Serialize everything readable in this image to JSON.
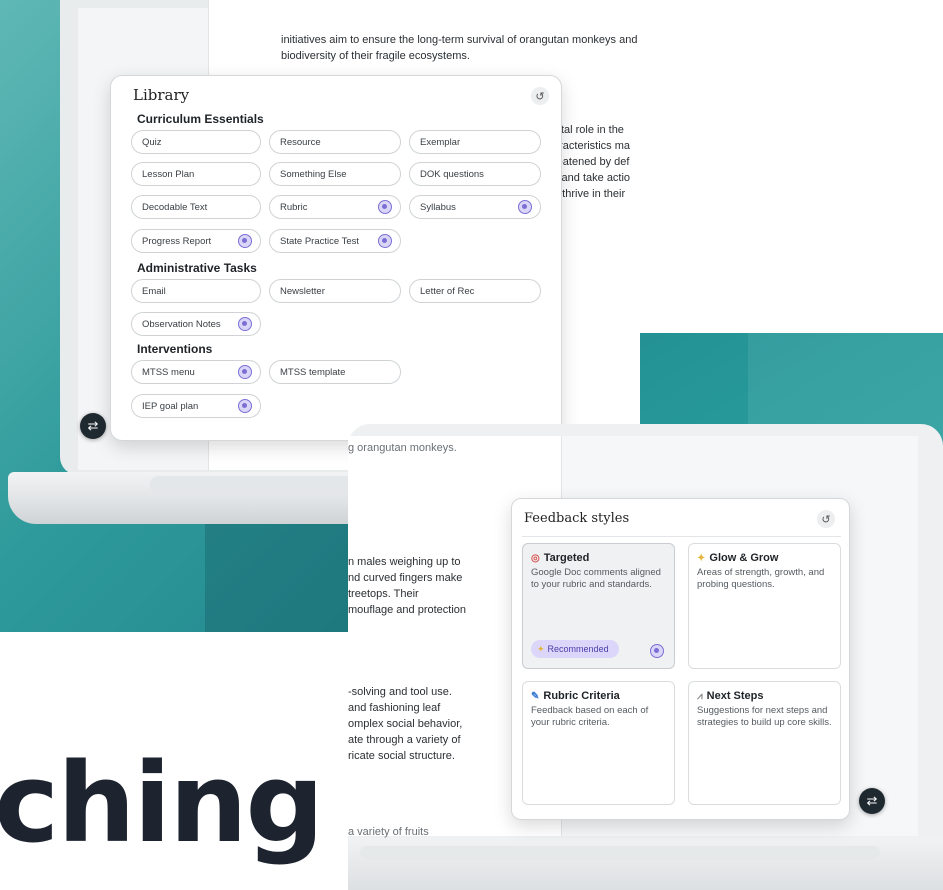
{
  "hero_word": "ching",
  "doc1": {
    "top_lines": [
      "initiatives aim to ensure the long-term survival of orangutan monkeys and",
      "biodiversity of their fragile ecosystems."
    ],
    "right_lines": [
      "vital role in the",
      "aracteristics ma",
      "reatened by def",
      "s and take actio",
      "o thrive in their"
    ]
  },
  "library": {
    "title": "Library",
    "sections": [
      {
        "heading": "Curriculum Essentials",
        "items": [
          {
            "label": "Quiz",
            "badge": false
          },
          {
            "label": "Resource",
            "badge": false
          },
          {
            "label": "Exemplar",
            "badge": false
          },
          {
            "label": "Lesson Plan",
            "badge": false
          },
          {
            "label": "Something Else",
            "badge": false
          },
          {
            "label": "DOK questions",
            "badge": false
          },
          {
            "label": "Decodable Text",
            "badge": false
          },
          {
            "label": "Rubric",
            "badge": true
          },
          {
            "label": "Syllabus",
            "badge": true
          },
          {
            "label": "Progress Report",
            "badge": true
          },
          {
            "label": "State Practice Test",
            "badge": true
          }
        ]
      },
      {
        "heading": "Administrative Tasks",
        "items": [
          {
            "label": "Email",
            "badge": false
          },
          {
            "label": "Newsletter",
            "badge": false
          },
          {
            "label": "Letter of Rec",
            "badge": false
          },
          {
            "label": "Observation Notes",
            "badge": true
          }
        ]
      },
      {
        "heading": "Interventions",
        "items": [
          {
            "label": "MTSS menu",
            "badge": true
          },
          {
            "label": "MTSS template",
            "badge": false
          },
          {
            "label": "IEP goal plan",
            "badge": true
          }
        ]
      }
    ]
  },
  "doc2": {
    "line_a": "g orangutan monkeys.",
    "block1": [
      "n males weighing up to",
      "nd curved fingers make",
      "treetops. Their",
      "mouflage and protection"
    ],
    "block2": [
      "-solving and tool use.",
      "and fashioning leaf",
      "omplex social behavior,",
      "ate through a variety of",
      "ricate social structure."
    ],
    "line_b": "a variety of fruits"
  },
  "feedback": {
    "title": "Feedback styles",
    "cards": [
      {
        "icon": "target-icon",
        "glyph": "◎",
        "title": "Targeted",
        "desc": "Google Doc comments aligned to your rubric and standards.",
        "recommended": "Recommended",
        "selected": true
      },
      {
        "icon": "sparkle-icon",
        "glyph": "✦",
        "title": "Glow & Grow",
        "desc": "Areas of strength, growth, and probing questions.",
        "selected": false
      },
      {
        "icon": "pencil-icon",
        "glyph": "✎",
        "title": "Rubric Criteria",
        "desc": "Feedback based on each of your rubric criteria.",
        "selected": false
      },
      {
        "icon": "road-icon",
        "glyph": "⩘",
        "title": "Next Steps",
        "desc": "Suggestions for next steps and strategies to build up core skills.",
        "selected": false
      }
    ]
  },
  "colors": {
    "teal": "#2e9a9b",
    "badge_purple": "#7b6fd6",
    "recommended_bg": "#ddd6fb"
  }
}
